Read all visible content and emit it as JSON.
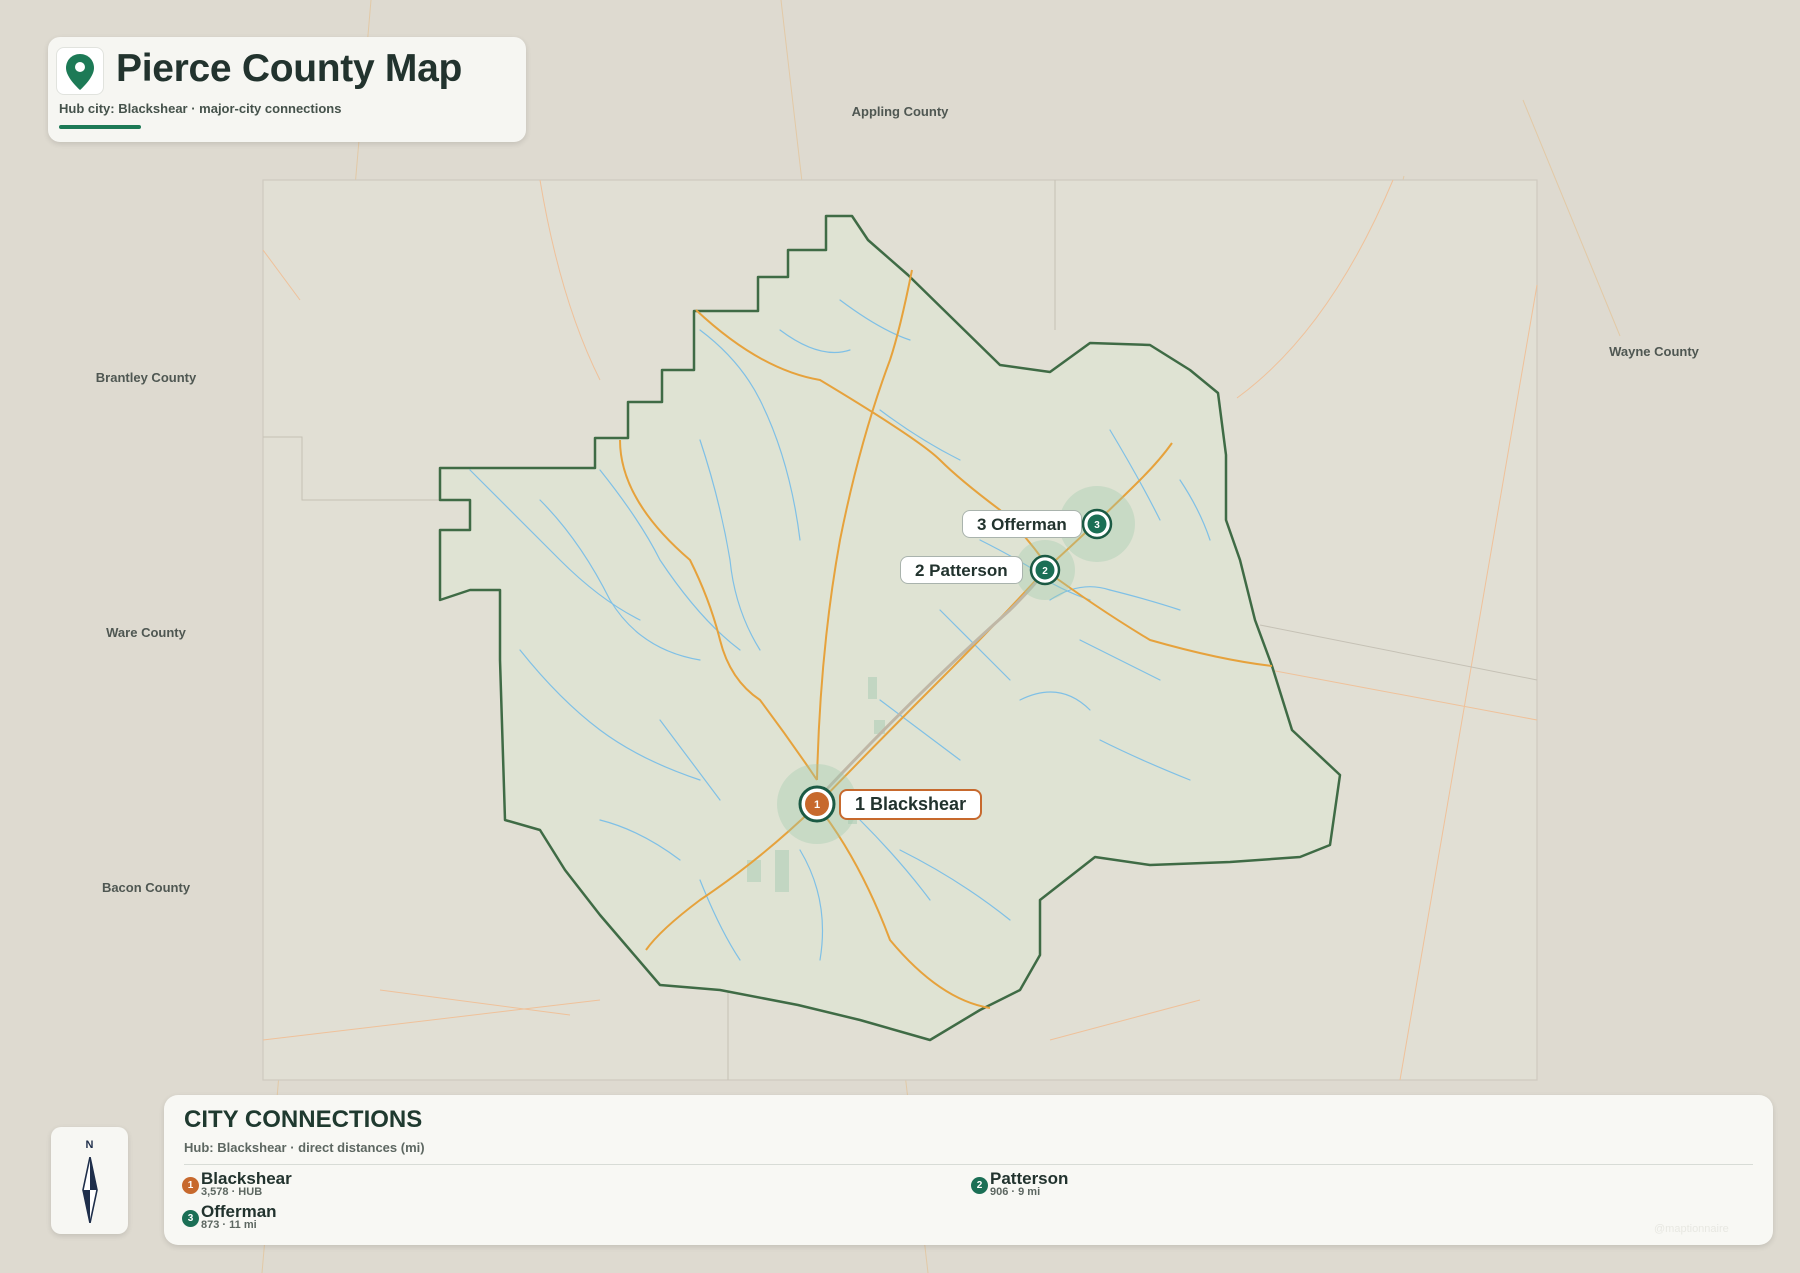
{
  "title": {
    "heading": "Pierce County Map",
    "subtitle": "Hub city: Blackshear · major-city connections",
    "icon": "map-pin-icon"
  },
  "colors": {
    "accent": "#1d7a56",
    "hub": "#c7692d",
    "county_boundary": "#3f6b45",
    "county_fill": "#dfe3d3",
    "roads": "#e6a23c",
    "water": "#7fc0e6",
    "background": "#dedad0"
  },
  "neighbors": [
    {
      "name": "Appling County"
    },
    {
      "name": "Wayne County"
    },
    {
      "name": "Brantley County"
    },
    {
      "name": "Ware County"
    },
    {
      "name": "Bacon County"
    }
  ],
  "cities": [
    {
      "num": "1",
      "name": "Blackshear",
      "map_label": "1 Blackshear",
      "population": "3,578",
      "detail": "3,578 · HUB",
      "is_hub": true
    },
    {
      "num": "2",
      "name": "Patterson",
      "map_label": "2 Patterson",
      "population": "906",
      "distance_mi": 9,
      "detail": "906 · 9 mi",
      "is_hub": false
    },
    {
      "num": "3",
      "name": "Offerman",
      "map_label": "3 Offerman",
      "population": "873",
      "distance_mi": 11,
      "detail": "873 · 11 mi",
      "is_hub": false
    }
  ],
  "compass": {
    "label": "N",
    "icon": "compass-arrow-icon"
  },
  "panel": {
    "title": "CITY CONNECTIONS",
    "subtitle": "Hub: Blackshear · direct distances (mi)"
  },
  "watermark": {
    "text": "@maptionnaire"
  }
}
